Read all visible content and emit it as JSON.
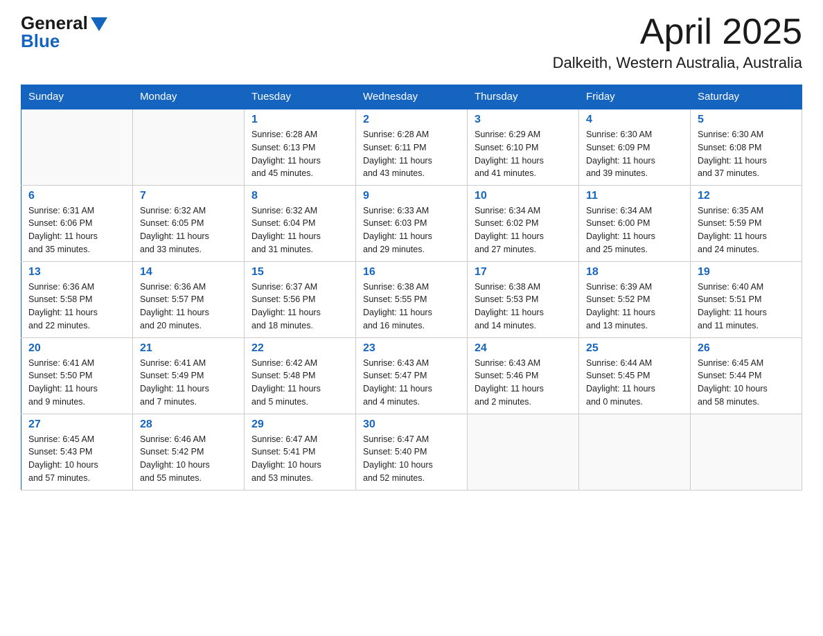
{
  "header": {
    "logo_text_general": "General",
    "logo_text_blue": "Blue",
    "month": "April 2025",
    "location": "Dalkeith, Western Australia, Australia"
  },
  "days_of_week": [
    "Sunday",
    "Monday",
    "Tuesday",
    "Wednesday",
    "Thursday",
    "Friday",
    "Saturday"
  ],
  "weeks": [
    [
      {
        "day": "",
        "info": ""
      },
      {
        "day": "",
        "info": ""
      },
      {
        "day": "1",
        "info": "Sunrise: 6:28 AM\nSunset: 6:13 PM\nDaylight: 11 hours\nand 45 minutes."
      },
      {
        "day": "2",
        "info": "Sunrise: 6:28 AM\nSunset: 6:11 PM\nDaylight: 11 hours\nand 43 minutes."
      },
      {
        "day": "3",
        "info": "Sunrise: 6:29 AM\nSunset: 6:10 PM\nDaylight: 11 hours\nand 41 minutes."
      },
      {
        "day": "4",
        "info": "Sunrise: 6:30 AM\nSunset: 6:09 PM\nDaylight: 11 hours\nand 39 minutes."
      },
      {
        "day": "5",
        "info": "Sunrise: 6:30 AM\nSunset: 6:08 PM\nDaylight: 11 hours\nand 37 minutes."
      }
    ],
    [
      {
        "day": "6",
        "info": "Sunrise: 6:31 AM\nSunset: 6:06 PM\nDaylight: 11 hours\nand 35 minutes."
      },
      {
        "day": "7",
        "info": "Sunrise: 6:32 AM\nSunset: 6:05 PM\nDaylight: 11 hours\nand 33 minutes."
      },
      {
        "day": "8",
        "info": "Sunrise: 6:32 AM\nSunset: 6:04 PM\nDaylight: 11 hours\nand 31 minutes."
      },
      {
        "day": "9",
        "info": "Sunrise: 6:33 AM\nSunset: 6:03 PM\nDaylight: 11 hours\nand 29 minutes."
      },
      {
        "day": "10",
        "info": "Sunrise: 6:34 AM\nSunset: 6:02 PM\nDaylight: 11 hours\nand 27 minutes."
      },
      {
        "day": "11",
        "info": "Sunrise: 6:34 AM\nSunset: 6:00 PM\nDaylight: 11 hours\nand 25 minutes."
      },
      {
        "day": "12",
        "info": "Sunrise: 6:35 AM\nSunset: 5:59 PM\nDaylight: 11 hours\nand 24 minutes."
      }
    ],
    [
      {
        "day": "13",
        "info": "Sunrise: 6:36 AM\nSunset: 5:58 PM\nDaylight: 11 hours\nand 22 minutes."
      },
      {
        "day": "14",
        "info": "Sunrise: 6:36 AM\nSunset: 5:57 PM\nDaylight: 11 hours\nand 20 minutes."
      },
      {
        "day": "15",
        "info": "Sunrise: 6:37 AM\nSunset: 5:56 PM\nDaylight: 11 hours\nand 18 minutes."
      },
      {
        "day": "16",
        "info": "Sunrise: 6:38 AM\nSunset: 5:55 PM\nDaylight: 11 hours\nand 16 minutes."
      },
      {
        "day": "17",
        "info": "Sunrise: 6:38 AM\nSunset: 5:53 PM\nDaylight: 11 hours\nand 14 minutes."
      },
      {
        "day": "18",
        "info": "Sunrise: 6:39 AM\nSunset: 5:52 PM\nDaylight: 11 hours\nand 13 minutes."
      },
      {
        "day": "19",
        "info": "Sunrise: 6:40 AM\nSunset: 5:51 PM\nDaylight: 11 hours\nand 11 minutes."
      }
    ],
    [
      {
        "day": "20",
        "info": "Sunrise: 6:41 AM\nSunset: 5:50 PM\nDaylight: 11 hours\nand 9 minutes."
      },
      {
        "day": "21",
        "info": "Sunrise: 6:41 AM\nSunset: 5:49 PM\nDaylight: 11 hours\nand 7 minutes."
      },
      {
        "day": "22",
        "info": "Sunrise: 6:42 AM\nSunset: 5:48 PM\nDaylight: 11 hours\nand 5 minutes."
      },
      {
        "day": "23",
        "info": "Sunrise: 6:43 AM\nSunset: 5:47 PM\nDaylight: 11 hours\nand 4 minutes."
      },
      {
        "day": "24",
        "info": "Sunrise: 6:43 AM\nSunset: 5:46 PM\nDaylight: 11 hours\nand 2 minutes."
      },
      {
        "day": "25",
        "info": "Sunrise: 6:44 AM\nSunset: 5:45 PM\nDaylight: 11 hours\nand 0 minutes."
      },
      {
        "day": "26",
        "info": "Sunrise: 6:45 AM\nSunset: 5:44 PM\nDaylight: 10 hours\nand 58 minutes."
      }
    ],
    [
      {
        "day": "27",
        "info": "Sunrise: 6:45 AM\nSunset: 5:43 PM\nDaylight: 10 hours\nand 57 minutes."
      },
      {
        "day": "28",
        "info": "Sunrise: 6:46 AM\nSunset: 5:42 PM\nDaylight: 10 hours\nand 55 minutes."
      },
      {
        "day": "29",
        "info": "Sunrise: 6:47 AM\nSunset: 5:41 PM\nDaylight: 10 hours\nand 53 minutes."
      },
      {
        "day": "30",
        "info": "Sunrise: 6:47 AM\nSunset: 5:40 PM\nDaylight: 10 hours\nand 52 minutes."
      },
      {
        "day": "",
        "info": ""
      },
      {
        "day": "",
        "info": ""
      },
      {
        "day": "",
        "info": ""
      }
    ]
  ]
}
